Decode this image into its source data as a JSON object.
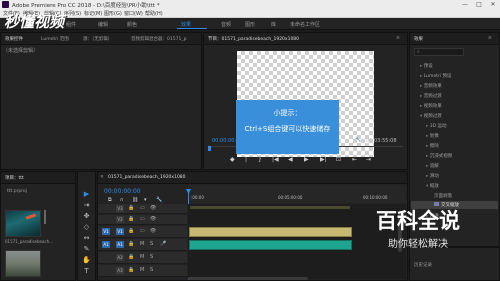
{
  "window": {
    "title": "Adobe Premiere Pro CC 2018 - D:\\百度经验\\PR小助\\ttt *",
    "minimize": "—",
    "maximize": "□",
    "close": "✕"
  },
  "menu": [
    "文件(F)",
    "编辑(E)",
    "剪辑(C)",
    "序列(S)",
    "标记(M)",
    "图形(G)",
    "窗口(W)",
    "帮助(H)"
  ],
  "workspaces": [
    "组件",
    "编辑",
    "颜色",
    "效果",
    "音频",
    "图形",
    "库",
    "未命名工作区"
  ],
  "active_workspace": "效果",
  "source_panel": {
    "tabs": [
      "效果控件",
      "Lumetri 范围",
      "源：（无剪辑）",
      "音频剪辑混合器：01571_p"
    ],
    "empty_text": "（未选择剪辑）"
  },
  "program_panel": {
    "tab": "节目：01571_paradisebeach_1920x1080",
    "timecode_left": "00:00:00:00",
    "fit_label": "适合",
    "timecode_right": "00:03:55:08",
    "controls": [
      "◆",
      "|",
      "{",
      "}",
      "|◀",
      "◀",
      "▶",
      "▶|",
      "⊡",
      "⇤",
      "⇥"
    ]
  },
  "tip": {
    "title": "小提示：",
    "body": "Ctrl+S组合键可以快速储存"
  },
  "effects_panel": {
    "tab": "效果",
    "tree": [
      "预设",
      "Lumetri 预设",
      "音频效果",
      "音频过渡",
      "视频效果",
      "视频过渡",
      "3D 运动",
      "划像",
      "擦除",
      "沉浸式视频",
      "溶解",
      "滑动",
      "缩放",
      "页面剥落",
      "交叉缩放",
      "内滑"
    ],
    "selected": "交叉缩放",
    "bottom_label": "历史记录"
  },
  "project_panel": {
    "tab": "项目：ttt",
    "file": "ttt.prproj",
    "clip_name": "01571_paradisebeach..."
  },
  "tools": [
    "▶",
    "⇥",
    "✥",
    "◇",
    "↔",
    "✎",
    "✋",
    "T"
  ],
  "timeline": {
    "tab": "01571_paradisebeach_1920x1080",
    "timecode": "00:00:00:00",
    "ruler": [
      ":00:00",
      "00:05:00:00",
      "00:10:00:00"
    ],
    "tracks": [
      {
        "name": "V3",
        "type": "video"
      },
      {
        "name": "V2",
        "type": "video"
      },
      {
        "name": "V1",
        "type": "video"
      },
      {
        "name": "A1",
        "type": "audio"
      },
      {
        "name": "A2",
        "type": "audio"
      },
      {
        "name": "A3",
        "type": "audio"
      }
    ]
  },
  "watermarks": {
    "baike_title": "百科全说",
    "baike_sub": "助你轻松解决",
    "sd_logo": "秒懂视频"
  },
  "colors": {
    "accent": "#2d8ceb",
    "tip_bg": "#3a8fdb",
    "video_clip": "#c7b873",
    "audio_clip": "#1ea58f"
  }
}
